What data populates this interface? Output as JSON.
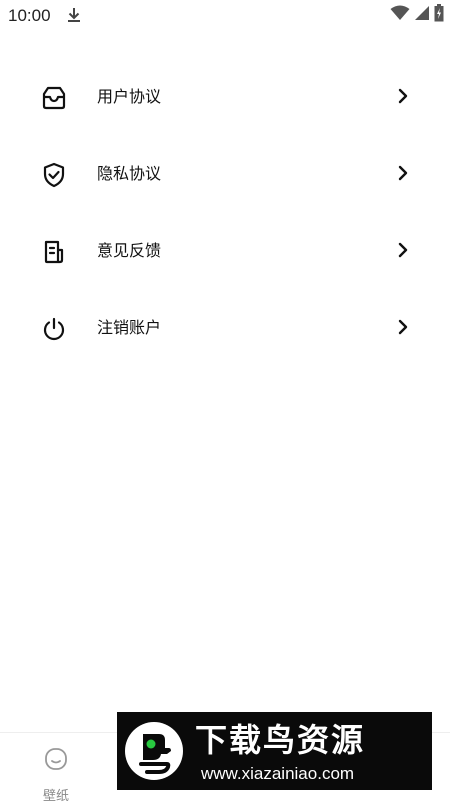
{
  "status_bar": {
    "time": "10:00",
    "icons": [
      "download-icon",
      "wifi-icon",
      "signal-icon",
      "battery-icon"
    ]
  },
  "menu": {
    "items": [
      {
        "label": "用户协议",
        "icon": "inbox-icon"
      },
      {
        "label": "隐私协议",
        "icon": "shield-check-icon"
      },
      {
        "label": "意见反馈",
        "icon": "feedback-document-icon"
      },
      {
        "label": "注销账户",
        "icon": "power-icon"
      }
    ],
    "chevron_icon": "chevron-right-icon"
  },
  "bottom_nav": {
    "items": [
      {
        "label": "壁纸",
        "icon": "wallpaper-face-icon"
      }
    ]
  },
  "watermark": {
    "title": "下载鸟资源",
    "url": "www.xiazainiao.com"
  },
  "colors": {
    "text": "#111111",
    "nav_inactive": "#888888",
    "watermark_bg": "#0a0a0a",
    "watermark_accent": "#28c940"
  }
}
